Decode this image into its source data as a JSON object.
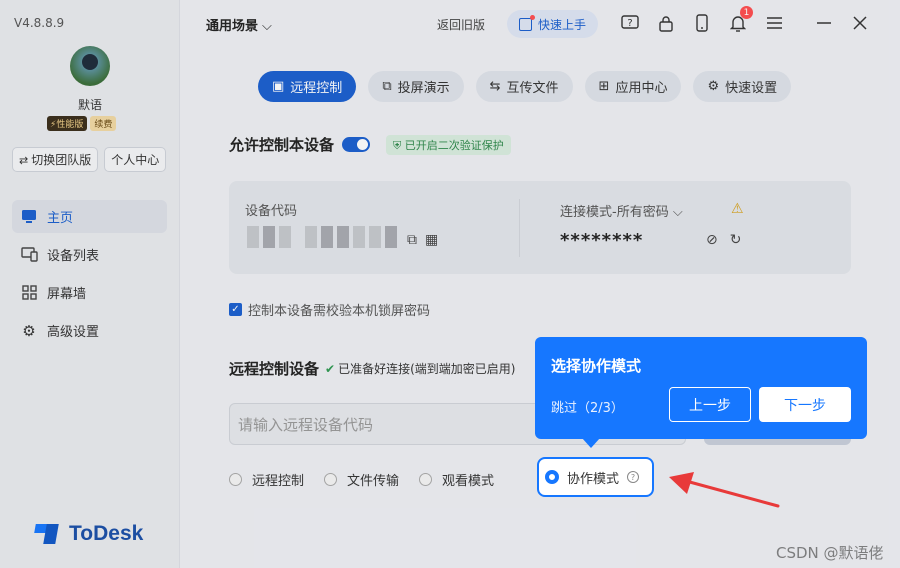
{
  "app": {
    "version": "V4.8.8.9",
    "brand": "ToDesk",
    "accent_color": "#1677ff"
  },
  "user": {
    "name": "默语",
    "badge_pro": "性能版",
    "badge_renew": "续费"
  },
  "sidebar": {
    "switch_team": "切换团队版",
    "personal_center": "个人中心",
    "items": [
      {
        "label": "主页",
        "icon": "monitor-icon",
        "active": true
      },
      {
        "label": "设备列表",
        "icon": "devices-icon",
        "active": false
      },
      {
        "label": "屏幕墙",
        "icon": "grid-icon",
        "active": false
      },
      {
        "label": "高级设置",
        "icon": "gear-icon",
        "active": false
      }
    ]
  },
  "topbar": {
    "scene": "通用场景",
    "old_version": "返回旧版",
    "quick_start": "快速上手",
    "notification_count": "1"
  },
  "tabs": [
    {
      "label": "远程控制",
      "active": true
    },
    {
      "label": "投屏演示",
      "active": false
    },
    {
      "label": "互传文件",
      "active": false
    },
    {
      "label": "应用中心",
      "active": false
    },
    {
      "label": "快速设置",
      "active": false
    }
  ],
  "allow": {
    "title": "允许控制本设备",
    "verify_badge": "已开启二次验证保护",
    "device_code_label": "设备代码",
    "connection_mode": "连接模式-所有密码",
    "password": "********",
    "lock_check": "控制本设备需校验本机锁屏密码"
  },
  "remote": {
    "title": "远程控制设备",
    "ready_text": "已准备好连接(端到端加密已启用)",
    "input_placeholder": "请输入远程设备代码",
    "modes": [
      "远程控制",
      "文件传输",
      "观看模式",
      "协作模式"
    ]
  },
  "guide": {
    "title": "选择协作模式",
    "skip": "跳过（2/3）",
    "prev": "上一步",
    "next": "下一步"
  },
  "watermark": "CSDN @默语佬"
}
